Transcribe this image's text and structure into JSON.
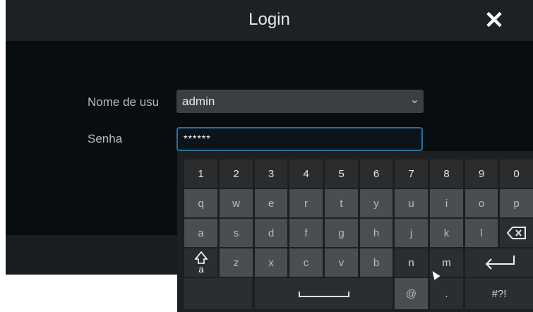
{
  "dialog": {
    "title": "Login",
    "close_icon": "close-icon"
  },
  "form": {
    "username_label": "Nome de usu",
    "username_value": "admin",
    "password_label": "Senha",
    "password_value": "******"
  },
  "keyboard": {
    "row1": [
      "1",
      "2",
      "3",
      "4",
      "5",
      "6",
      "7",
      "8",
      "9",
      "0"
    ],
    "row2": [
      "q",
      "w",
      "e",
      "r",
      "t",
      "y",
      "u",
      "i",
      "o",
      "p"
    ],
    "row3": [
      "a",
      "s",
      "d",
      "f",
      "g",
      "h",
      "j",
      "k",
      "l"
    ],
    "row4": [
      "z",
      "x",
      "c",
      "v",
      "b",
      "n",
      "m"
    ],
    "at": "@",
    "dot": ".",
    "symbols": "#?!"
  }
}
